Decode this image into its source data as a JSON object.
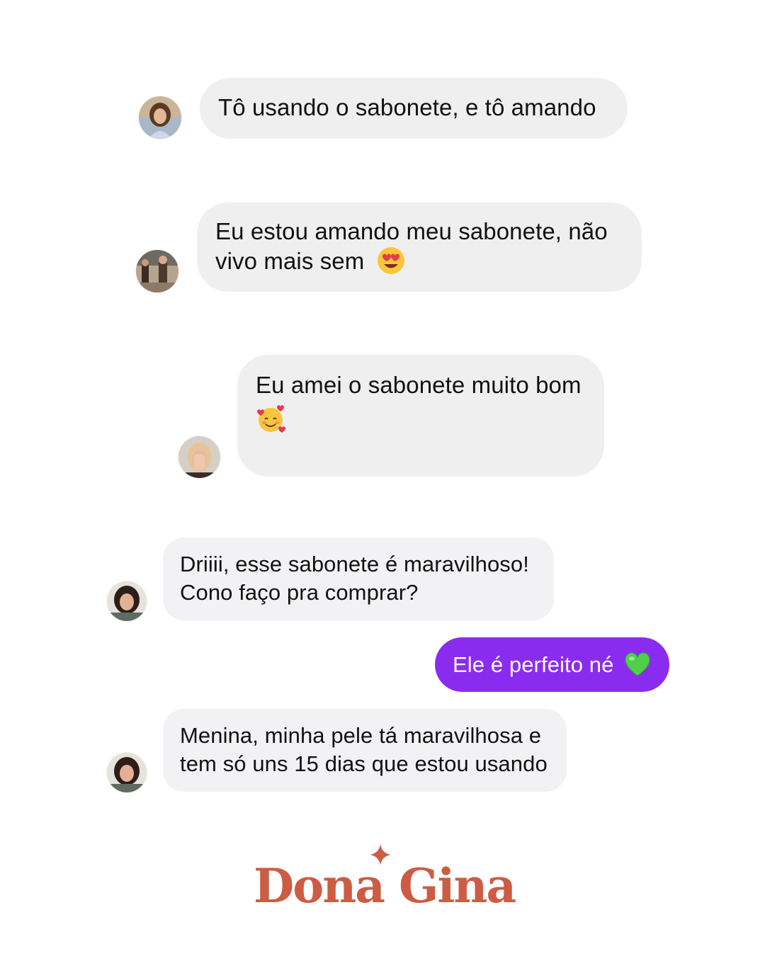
{
  "messages": [
    {
      "text": "Tô usando o sabonete, e tô amando"
    },
    {
      "lines": [
        "Eu estou amando meu sabonete, não",
        "vivo mais sem"
      ],
      "emoji": "heart-eyes-emoji"
    },
    {
      "lines": [
        "Eu amei o sabonete muito bom"
      ],
      "emoji": "smiling-face-with-hearts-emoji"
    },
    {
      "lines": [
        "Driiii, esse sabonete é maravilhoso!",
        "Cono faço pra comprar?"
      ]
    },
    {
      "text": "Ele é perfeito né",
      "emoji": "green-heart-emoji"
    },
    {
      "lines": [
        "Menina, minha pele tá maravilhosa e",
        "tem só uns 15 dias que estou usando"
      ]
    }
  ],
  "brand": {
    "name": "Dona Gina"
  },
  "colors": {
    "incoming_bubble": "#efefef",
    "sent_bubble": "#8a2cf0",
    "brand": "#cc5c44",
    "background": "#ffffff"
  },
  "icons": [
    "avatar",
    "heart-eyes-emoji",
    "smiling-face-with-hearts-emoji",
    "green-heart-emoji",
    "sparkle-icon"
  ]
}
